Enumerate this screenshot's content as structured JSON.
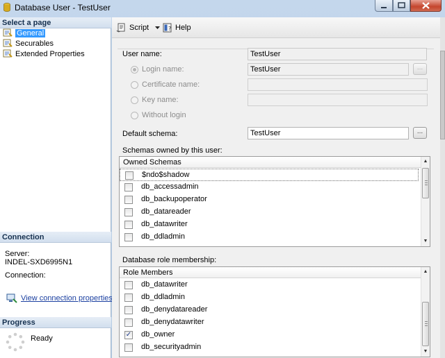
{
  "window": {
    "title": "Database User - TestUser"
  },
  "left_panel": {
    "select_page_header": "Select a page",
    "pages": [
      {
        "label": "General",
        "icon": "page-icon",
        "selected": true
      },
      {
        "label": "Securables",
        "icon": "page-icon",
        "selected": false
      },
      {
        "label": "Extended Properties",
        "icon": "page-icon",
        "selected": false
      }
    ],
    "connection": {
      "header": "Connection",
      "server_label": "Server:",
      "server_value": "INDEL-SXD6995N1",
      "connection_label": "Connection:",
      "view_link": "View connection properties"
    },
    "progress": {
      "header": "Progress",
      "status": "Ready"
    }
  },
  "toolbar": {
    "script_label": "Script",
    "help_label": "Help"
  },
  "general": {
    "user_name_label": "User name:",
    "user_name_value": "TestUser",
    "login_name_label": "Login name:",
    "login_name_value": "TestUser",
    "certificate_name_label": "Certificate name:",
    "key_name_label": "Key name:",
    "without_login_label": "Without login",
    "default_schema_label": "Default schema:",
    "default_schema_value": "TestUser",
    "browse_label": "..."
  },
  "schemas": {
    "section_label": "Schemas owned by this user:",
    "column_header": "Owned Schemas",
    "items": [
      {
        "name": "$ndo$shadow",
        "checked": false
      },
      {
        "name": "db_accessadmin",
        "checked": false
      },
      {
        "name": "db_backupoperator",
        "checked": false
      },
      {
        "name": "db_datareader",
        "checked": false
      },
      {
        "name": "db_datawriter",
        "checked": false
      },
      {
        "name": "db_ddladmin",
        "checked": false
      }
    ]
  },
  "roles": {
    "section_label": "Database role membership:",
    "column_header": "Role Members",
    "items": [
      {
        "name": "db_datawriter",
        "checked": false
      },
      {
        "name": "db_ddladmin",
        "checked": false
      },
      {
        "name": "db_denydatareader",
        "checked": false
      },
      {
        "name": "db_denydatawriter",
        "checked": false
      },
      {
        "name": "db_owner",
        "checked": true
      },
      {
        "name": "db_securityadmin",
        "checked": false
      }
    ]
  },
  "colors": {
    "selection": "#3399ff",
    "link": "#1a3fa0",
    "window_frame": "#b4cbe3",
    "close_button": "#c4452d"
  }
}
